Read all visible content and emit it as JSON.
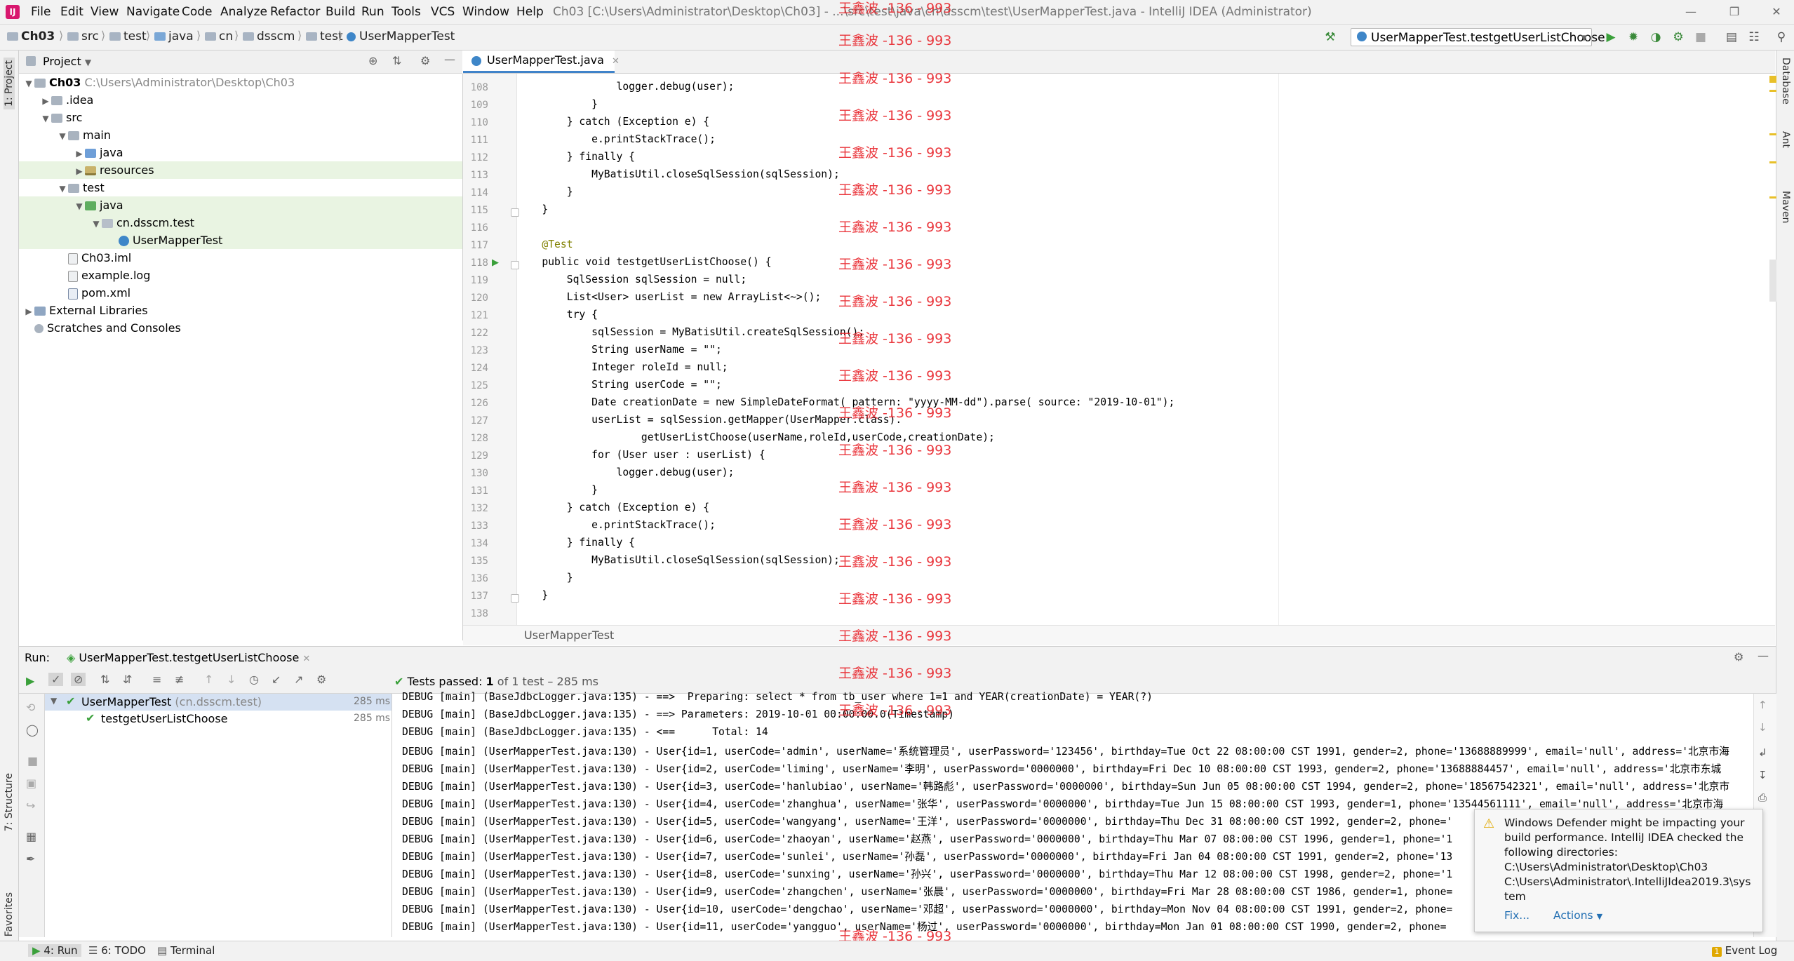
{
  "window": {
    "title": "Ch03 [C:\\Users\\Administrator\\Desktop\\Ch03] - ...\\src\\test\\java\\cn\\dsscm\\test\\UserMapperTest.java - IntelliJ IDEA (Administrator)",
    "menu": [
      "File",
      "Edit",
      "View",
      "Navigate",
      "Code",
      "Analyze",
      "Refactor",
      "Build",
      "Run",
      "Tools",
      "VCS",
      "Window",
      "Help"
    ]
  },
  "navbar": {
    "crumbs": [
      "Ch03",
      "src",
      "test",
      "java",
      "cn",
      "dsscm",
      "test",
      "UserMapperTest"
    ],
    "run_config": "UserMapperTest.testgetUserListChoose"
  },
  "left_tabs": [
    "1: Project",
    "7: Structure",
    "2: Favorites"
  ],
  "right_tabs": [
    "Database",
    "Ant",
    "Maven"
  ],
  "project": {
    "header": "Project",
    "tree": [
      {
        "label": "Ch03",
        "extra": "C:\\Users\\Administrator\\Desktop\\Ch03"
      },
      {
        "label": ".idea"
      },
      {
        "label": "src"
      },
      {
        "label": "main"
      },
      {
        "label": "java"
      },
      {
        "label": "resources"
      },
      {
        "label": "test"
      },
      {
        "label": "java"
      },
      {
        "label": "cn.dsscm.test"
      },
      {
        "label": "UserMapperTest"
      },
      {
        "label": "Ch03.iml"
      },
      {
        "label": "example.log"
      },
      {
        "label": "pom.xml"
      },
      {
        "label": "External Libraries"
      },
      {
        "label": "Scratches and Consoles"
      }
    ]
  },
  "editor": {
    "tab": "UserMapperTest.java",
    "breadcrumb": "UserMapperTest",
    "lines": [
      {
        "n": "108",
        "code": "                logger.debug(user);"
      },
      {
        "n": "109",
        "code": "            }"
      },
      {
        "n": "110",
        "code": "        } catch (Exception e) {"
      },
      {
        "n": "111",
        "code": "            e.printStackTrace();"
      },
      {
        "n": "112",
        "code": "        } finally {"
      },
      {
        "n": "113",
        "code": "            MyBatisUtil.closeSqlSession(sqlSession);"
      },
      {
        "n": "114",
        "code": "        }"
      },
      {
        "n": "115",
        "code": "    }"
      },
      {
        "n": "116",
        "code": ""
      },
      {
        "n": "117",
        "code": "    @Test"
      },
      {
        "n": "118",
        "code": "    public void testgetUserListChoose() {"
      },
      {
        "n": "119",
        "code": "        SqlSession sqlSession = null;"
      },
      {
        "n": "120",
        "code": "        List<User> userList = new ArrayList<~>();"
      },
      {
        "n": "121",
        "code": "        try {"
      },
      {
        "n": "122",
        "code": "            sqlSession = MyBatisUtil.createSqlSession();"
      },
      {
        "n": "123",
        "code": "            String userName = \"\";"
      },
      {
        "n": "124",
        "code": "            Integer roleId = null;"
      },
      {
        "n": "125",
        "code": "            String userCode = \"\";"
      },
      {
        "n": "126",
        "code": "            Date creationDate = new SimpleDateFormat( pattern: \"yyyy-MM-dd\").parse( source: \"2019-10-01\");"
      },
      {
        "n": "127",
        "code": "            userList = sqlSession.getMapper(UserMapper.class)."
      },
      {
        "n": "128",
        "code": "                    getUserListChoose(userName,roleId,userCode,creationDate);"
      },
      {
        "n": "129",
        "code": "            for (User user : userList) {"
      },
      {
        "n": "130",
        "code": "                logger.debug(user);"
      },
      {
        "n": "131",
        "code": "            }"
      },
      {
        "n": "132",
        "code": "        } catch (Exception e) {"
      },
      {
        "n": "133",
        "code": "            e.printStackTrace();"
      },
      {
        "n": "134",
        "code": "        } finally {"
      },
      {
        "n": "135",
        "code": "            MyBatisUtil.closeSqlSession(sqlSession);"
      },
      {
        "n": "136",
        "code": "        }"
      },
      {
        "n": "137",
        "code": "    }"
      },
      {
        "n": "138",
        "code": ""
      }
    ]
  },
  "watermark": "王鑫波 -136 - 993",
  "run": {
    "label": "Run:",
    "tab": "UserMapperTest.testgetUserListChoose",
    "status_prefix": "Tests passed:",
    "status_count": "1",
    "status_suffix": "of 1 test – 285 ms",
    "tree": [
      {
        "name": "UserMapperTest",
        "pkg": "(cn.dsscm.test)",
        "time": "285 ms"
      },
      {
        "name": "testgetUserListChoose",
        "pkg": "",
        "time": "285 ms"
      }
    ],
    "console": [
      "DEBUG [main] (BaseJdbcLogger.java:135) - ==>  Preparing: select * from tb_user where 1=1 and YEAR(creationDate) = YEAR(?)",
      "DEBUG [main] (BaseJdbcLogger.java:135) - ==> Parameters: 2019-10-01 00:00:00.0(Timestamp)",
      "DEBUG [main] (BaseJdbcLogger.java:135) - <==      Total: 14",
      "DEBUG [main] (UserMapperTest.java:130) - User{id=1, userCode='admin', userName='系统管理员', userPassword='123456', birthday=Tue Oct 22 08:00:00 CST 1991, gender=2, phone='13688889999', email='null', address='北京市海",
      "DEBUG [main] (UserMapperTest.java:130) - User{id=2, userCode='liming', userName='李明', userPassword='0000000', birthday=Fri Dec 10 08:00:00 CST 1993, gender=2, phone='13688884457', email='null', address='北京市东城",
      "DEBUG [main] (UserMapperTest.java:130) - User{id=3, userCode='hanlubiao', userName='韩路彪', userPassword='0000000', birthday=Sun Jun 05 08:00:00 CST 1994, gender=2, phone='18567542321', email='null', address='北京市",
      "DEBUG [main] (UserMapperTest.java:130) - User{id=4, userCode='zhanghua', userName='张华', userPassword='0000000', birthday=Tue Jun 15 08:00:00 CST 1993, gender=1, phone='13544561111', email='null', address='北京市海",
      "DEBUG [main] (UserMapperTest.java:130) - User{id=5, userCode='wangyang', userName='王洋', userPassword='0000000', birthday=Thu Dec 31 08:00:00 CST 1992, gender=2, phone='",
      "DEBUG [main] (UserMapperTest.java:130) - User{id=6, userCode='zhaoyan', userName='赵燕', userPassword='0000000', birthday=Thu Mar 07 08:00:00 CST 1996, gender=1, phone='1",
      "DEBUG [main] (UserMapperTest.java:130) - User{id=7, userCode='sunlei', userName='孙磊', userPassword='0000000', birthday=Fri Jan 04 08:00:00 CST 1991, gender=2, phone='13",
      "DEBUG [main] (UserMapperTest.java:130) - User{id=8, userCode='sunxing', userName='孙兴', userPassword='0000000', birthday=Thu Mar 12 08:00:00 CST 1998, gender=2, phone='1",
      "DEBUG [main] (UserMapperTest.java:130) - User{id=9, userCode='zhangchen', userName='张晨', userPassword='0000000', birthday=Fri Mar 28 08:00:00 CST 1986, gender=1, phone=",
      "DEBUG [main] (UserMapperTest.java:130) - User{id=10, userCode='dengchao', userName='邓超', userPassword='0000000', birthday=Mon Nov 04 08:00:00 CST 1991, gender=2, phone=",
      "DEBUG [main] (UserMapperTest.java:130) - User{id=11, userCode='yangguo', userName='杨过', userPassword='0000000', birthday=Mon Jan 01 08:00:00 CST 1990, gender=2, phone="
    ]
  },
  "notification": {
    "lines": [
      "Windows Defender might be impacting your",
      "build performance. IntelliJ IDEA checked the",
      "following directories:",
      "C:\\Users\\Administrator\\Desktop\\Ch03",
      "C:\\Users\\Administrator\\.IntelliJIdea2019.3\\sys",
      "tem"
    ],
    "fix": "Fix...",
    "actions": "Actions"
  },
  "statusbar": {
    "run": "4: Run",
    "todo": "6: TODO",
    "terminal": "Terminal",
    "event_log": "Event Log",
    "event_count": "1"
  },
  "colors": {
    "accent": "#4083c9",
    "selection": "#e9f4e2",
    "watermark": "#e8232a",
    "pass": "#3aa03a"
  }
}
